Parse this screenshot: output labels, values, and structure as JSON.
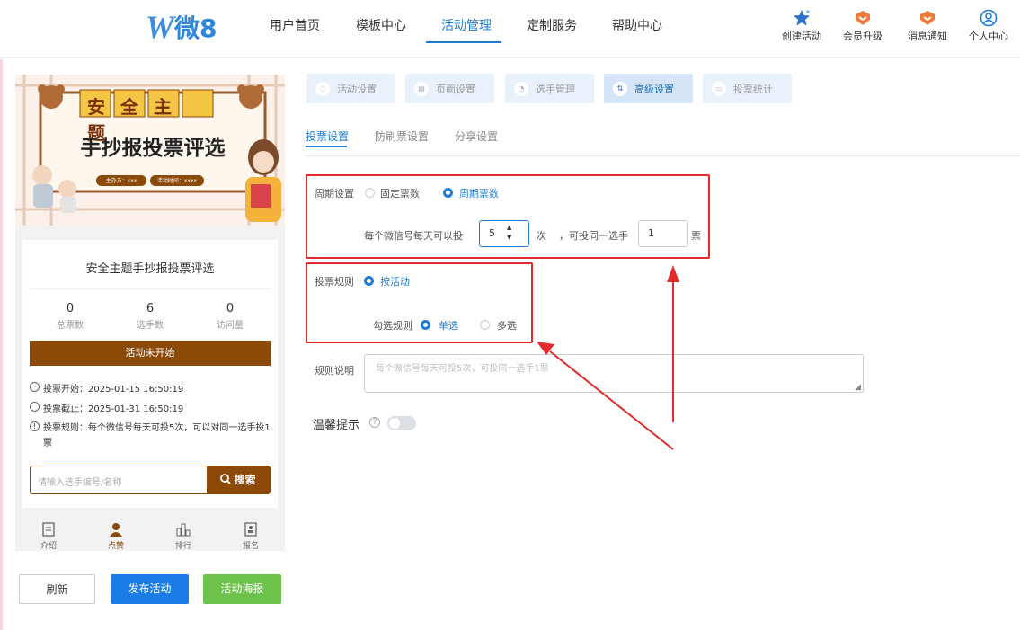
{
  "header": {
    "logo_w": "W",
    "logo_text": "微8",
    "nav": [
      "用户首页",
      "模板中心",
      "活动管理",
      "定制服务",
      "帮助中心"
    ],
    "icons": [
      {
        "label": "创建活动",
        "icon": "star-icon"
      },
      {
        "label": "会员升级",
        "icon": "member-upgrade-icon"
      },
      {
        "label": "消息通知",
        "icon": "notification-icon"
      },
      {
        "label": "个人中心",
        "icon": "user-icon"
      }
    ]
  },
  "preview": {
    "banner_top": "安全主题",
    "banner_main": "手抄报投票评选",
    "banner_host": "主办方：xxx",
    "banner_time": "活动时间：xxxx",
    "title": "安全主题手抄报投票评选",
    "stats": [
      {
        "value": "0",
        "label": "总票数"
      },
      {
        "value": "6",
        "label": "选手数"
      },
      {
        "value": "0",
        "label": "访问量"
      }
    ],
    "status": "活动未开始",
    "info": [
      "投票开始：2025-01-15 16:50:19",
      "投票截止：2025-01-31 16:50:19",
      "投票规则：每个微信号每天可投5次，可以对同一选手投1票"
    ],
    "search_placeholder": "请输入选手编号/名称",
    "search_button": "搜索",
    "tabs": [
      "介绍",
      "点赞",
      "排行",
      "报名"
    ],
    "btn_refresh": "刷新",
    "btn_publish": "发布活动",
    "btn_poster": "活动海报"
  },
  "steps": [
    "活动设置",
    "页面设置",
    "选手管理",
    "高级设置",
    "投票统计"
  ],
  "subtabs": [
    "投票设置",
    "防刷票设置",
    "分享设置"
  ],
  "form": {
    "cycle_label": "周期设置",
    "cycle_opt1": "固定票数",
    "cycle_opt2": "周期票数",
    "per_day_label": "每个微信号每天可以投",
    "per_day_value": "5",
    "unit_times": "次",
    "same_player_label": "，可投同一选手",
    "same_player_value": "1",
    "unit_votes": "票",
    "rule_label": "投票规则",
    "rule_opt": "按活动",
    "check_label": "勾选规则",
    "check_single": "单选",
    "check_multi": "多选",
    "desc_label": "规则说明",
    "desc_placeholder": "每个微信号每天可投5次，可投同一选手1票",
    "tip_label": "温馨提示"
  },
  "colors": {
    "accent": "#1f7dd6",
    "brown": "#8b4a08",
    "green": "#6cc24a",
    "blue_btn": "#1a7de6",
    "annotation": "#e32b2b"
  }
}
